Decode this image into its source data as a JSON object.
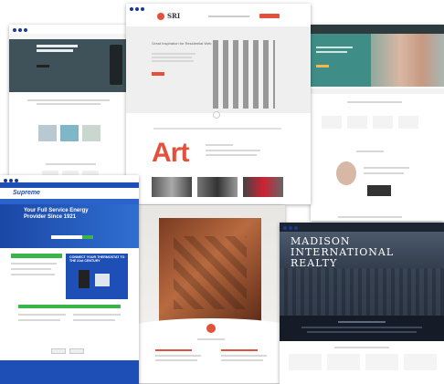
{
  "sri": {
    "logo_text": "SRI",
    "hero_text": "Great Inspiration for Residential Web",
    "section_word": "Art"
  },
  "supreme": {
    "logo_text": "Supreme",
    "headline": "Your Full Service Energy Provider Since 1921",
    "promo": "CONNECT YOUR THERMOSTAT TO THE 21st CENTURY"
  },
  "madison": {
    "title_line1": "MADISON",
    "title_line2": "INTERNATIONAL",
    "title_line3": "REALTY"
  },
  "colors": {
    "accent_red": "#e4503a",
    "supreme_blue": "#1d4fb7",
    "teal": "#3e8d86",
    "madison_dark": "#1c2431",
    "navy": "#1a3a8c"
  }
}
